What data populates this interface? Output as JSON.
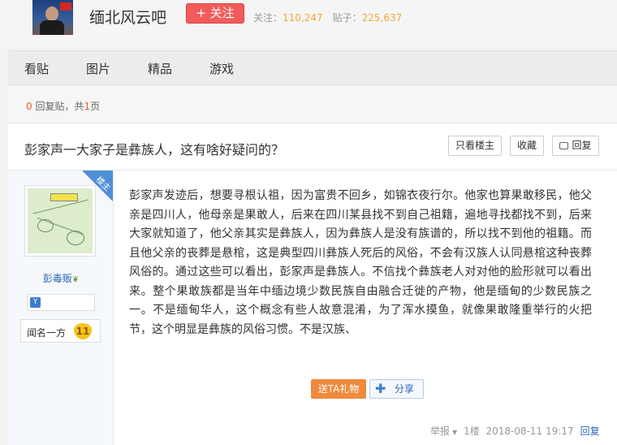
{
  "header": {
    "forum_name": "缅北风云吧",
    "follow_label": "+ 关注",
    "follow_stat_label": "关注：",
    "follow_count": "110,247",
    "posts_stat_label": "贴子：",
    "posts_count": "225,637"
  },
  "nav": {
    "items": [
      {
        "label": "看贴"
      },
      {
        "label": "图片"
      },
      {
        "label": "精品"
      },
      {
        "label": "游戏"
      }
    ]
  },
  "pager": {
    "reply_count": "0",
    "reply_label": " 回复贴，共",
    "page_count": "1",
    "page_suffix": "页"
  },
  "post": {
    "title": "彭家声一大家子是彝族人，这有啥好疑问的？",
    "only_op_label": "只看楼主",
    "favorite_label": "收藏",
    "reply_label": "回复",
    "op_badge": "楼主",
    "author": "彭毒贩",
    "level_title": "闻名一方",
    "level_number": "11",
    "body": "彭家声发迹后，想要寻根认祖，因为富贵不回乡，如锦衣夜行尔。他家也算果敢移民，他父亲是四川人，他母亲是果敢人，后来在四川某县找不到自己祖籍，遍地寻找都找不到，后来大家就知道了，他父亲其实是彝族人，因为彝族人是没有族谱的，所以找不到他的祖籍。而且他父亲的丧葬是悬棺，这是典型四川彝族人死后的风俗，不会有汉族人认同悬棺这种丧葬风俗的。通过这些可以看出，彭家声是彝族人。不信找个彝族老人对对他的脸形就可以看出来。整个果敢族都是当年中缅边境少数民族自由融合迁徙的产物，他是缅甸的少数民族之一。不是缅甸华人，这个概念有些人故意混淆，为了浑水摸鱼，就像果敢隆重举行的火把节，这个明显是彝族的风俗习惯。不是汉族、",
    "gift_label": "送TA礼物",
    "share_label": "分享",
    "report_label": "举报",
    "floor": "1楼",
    "timestamp": "2018-08-11 19:17",
    "reply_link": "回复"
  },
  "colors": {
    "accent_red": "#f35b5b",
    "count_orange": "#f4a63a",
    "link_blue": "#2d64b3",
    "gift_orange": "#ef8a3d"
  }
}
